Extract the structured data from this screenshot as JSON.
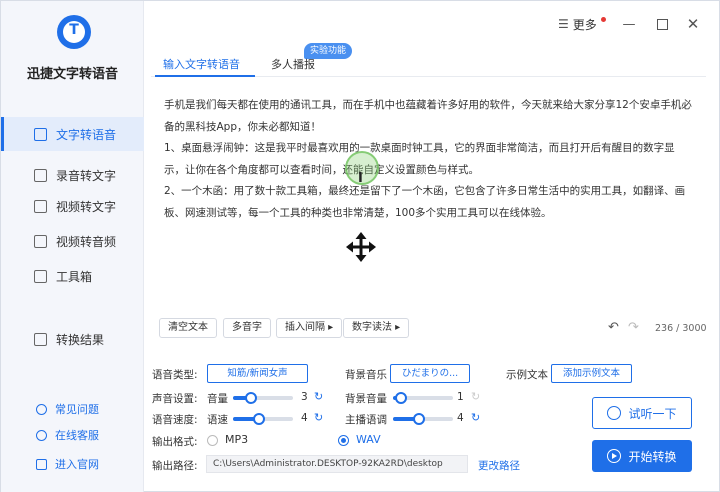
{
  "app": {
    "title": "迅捷文字转语音"
  },
  "titlebar": {
    "more_label": "更多"
  },
  "sidebar": {
    "items": [
      {
        "label": "文字转语音",
        "icon": "text-to-speech-icon",
        "active": true
      },
      {
        "label": "录音转文字",
        "icon": "recording-icon",
        "active": false
      },
      {
        "label": "视频转文字",
        "icon": "video-icon",
        "active": false
      },
      {
        "label": "视频转音频",
        "icon": "video-audio-icon",
        "active": false
      },
      {
        "label": "工具箱",
        "icon": "toolbox-icon",
        "active": false
      },
      {
        "label": "转换结果",
        "icon": "result-icon",
        "active": false
      }
    ],
    "footer": [
      {
        "label": "常见问题",
        "icon": "help-icon"
      },
      {
        "label": "在线客服",
        "icon": "support-icon"
      },
      {
        "label": "进入官网",
        "icon": "website-icon"
      }
    ]
  },
  "tabs": [
    {
      "label": "输入文字转语音",
      "active": true
    },
    {
      "label": "多人播报",
      "active": false
    }
  ],
  "badge": "实验功能",
  "editor": {
    "lines": [
      "手机是我们每天都在使用的通讯工具，而在手机中也蕴藏着许多好用的软件，今天就来给大家分享12个安卓手机必备的黑科技App，你未必都知道！",
      "1、桌面悬浮闹钟：这是我平时最喜欢用的一款桌面时钟工具，它的界面非常简洁，而且打开后有醒目的数字显示，让你在各个角度都可以查看时间，还能自定义设置颜色与样式。",
      "2、一个木函：用了数十款工具箱，最终还是留下了一个木函，它包含了许多日常生活中的实用工具，如翻译、画板、网速测试等，每一个工具的种类也非常清楚，100多个实用工具可以在线体验。"
    ],
    "chips": [
      "清空文本",
      "多音字",
      "插入间隔 ▸",
      "数字读法 ▸"
    ],
    "counter": "236 / 3000"
  },
  "settings": {
    "voice_type_label": "语音类型:",
    "voice_type_value": "知筋/新闻女声",
    "bgm_label": "背景音乐",
    "bgm_value": "ひだまりの...",
    "sample_label": "示例文本",
    "sample_button": "添加示例文本",
    "sound_label": "声音设置:",
    "volume_label": "音量",
    "volume_value": "3",
    "bg_volume_label": "背景音量",
    "bg_volume_value": "1",
    "speed_label": "语音速度:",
    "rate_label": "语速",
    "rate_value": "4",
    "pitch_label": "主播语调",
    "pitch_value": "4",
    "format_label": "输出格式:",
    "format_mp3": "MP3",
    "format_wav": "WAV",
    "format_selected": "WAV",
    "path_label": "输出路径:",
    "path_value": "C:\\Users\\Administrator.DESKTOP-92KA2RD\\desktop",
    "change_path": "更改路径"
  },
  "actions": {
    "listen": "试听一下",
    "start": "开始转换"
  },
  "colors": {
    "accent": "#1f6fe8",
    "sidebar_bg": "#f4f6fb",
    "badge": "#4a90f0"
  }
}
